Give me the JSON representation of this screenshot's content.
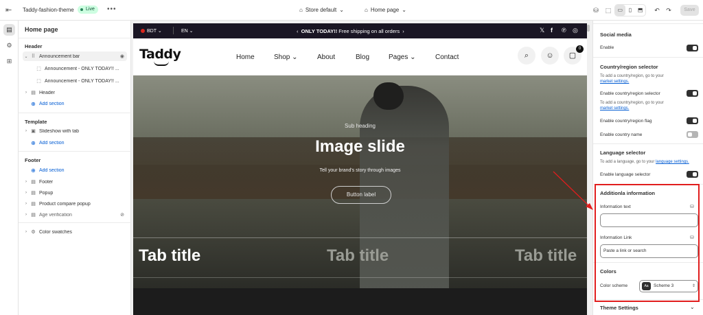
{
  "topbar": {
    "theme_name": "Taddy-fashion-theme",
    "live_label": "Live",
    "more": "•••",
    "store_label": "Store default",
    "page_label": "Home page",
    "save_label": "Save"
  },
  "left_panel": {
    "title": "Home page",
    "header_group": "Header",
    "announcement_bar": "Announcement bar",
    "announcement_1": "Announcement - ONLY TODAY!! ...",
    "announcement_2": "Announcement - ONLY TODAY!! ...",
    "header_item": "Header",
    "add_section": "Add section",
    "template_group": "Template",
    "slideshow": "Slideshow with tab",
    "footer_group": "Footer",
    "footer_item": "Footer",
    "popup": "Popup",
    "compare_popup": "Product compare popup",
    "age_verification": "Age verification",
    "color_swatches": "Color swatches"
  },
  "preview": {
    "currency": "BDT",
    "language": "EN",
    "announcement_bold": "ONLY TODAY!!",
    "announcement_rest": " Free shipping on all orders",
    "logo": "Taddy",
    "nav": [
      "Home",
      "Shop",
      "About",
      "Blog",
      "Pages",
      "Contact"
    ],
    "cart_count": "0",
    "subheading": "Sub heading",
    "slide_title": "Image slide",
    "slide_desc": "Tell your brand's story through images",
    "button_label": "Button label",
    "tab_titles": [
      "Tab title",
      "Tab title",
      "Tab title"
    ]
  },
  "right_panel": {
    "social_media": "Social media",
    "enable": "Enable",
    "country_selector": "Country/region selector",
    "country_hint": "To add a country/region, go to your",
    "market_settings": "market settings.",
    "enable_country_selector": "Enable country/region selector",
    "country_hint_2": "To add a country/region, go to your",
    "market_settings_2": "market settings.",
    "enable_flag": "Enable country/region flag",
    "enable_country_name": "Enable country name",
    "language_selector": "Language selector",
    "language_hint": "To add a language, go to your",
    "language_settings": "language settings.",
    "enable_language_selector": "Enable language selector",
    "additional_info": "Additionla information",
    "information_text": "Information text",
    "information_text_value": "",
    "information_link": "Information Link",
    "information_link_placeholder": "Paste a link or search",
    "colors": "Colors",
    "color_scheme": "Color scheme",
    "scheme_value": "Scheme 3",
    "scheme_badge": "Aa",
    "theme_settings": "Theme Settings"
  },
  "colors": {
    "accent_blue": "#005bd3",
    "annotation_red": "#e11d1d",
    "live_green": "#29845a"
  }
}
